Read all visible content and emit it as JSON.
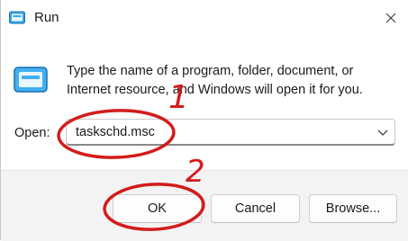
{
  "window": {
    "title": "Run"
  },
  "dialog": {
    "description_line1": "Type the name of a program, folder, document, or",
    "description_line2": "Internet resource, and Windows will open it for you.",
    "open_label": "Open:",
    "open_value": "taskschd.msc"
  },
  "buttons": {
    "ok": "OK",
    "cancel": "Cancel",
    "browse": "Browse..."
  },
  "annotations": {
    "step1": "1",
    "step2": "2",
    "color": "#d21c1c"
  },
  "icons": {
    "title": "run-icon",
    "body": "run-icon",
    "close": "close-icon",
    "dropdown": "chevron-down-icon"
  }
}
